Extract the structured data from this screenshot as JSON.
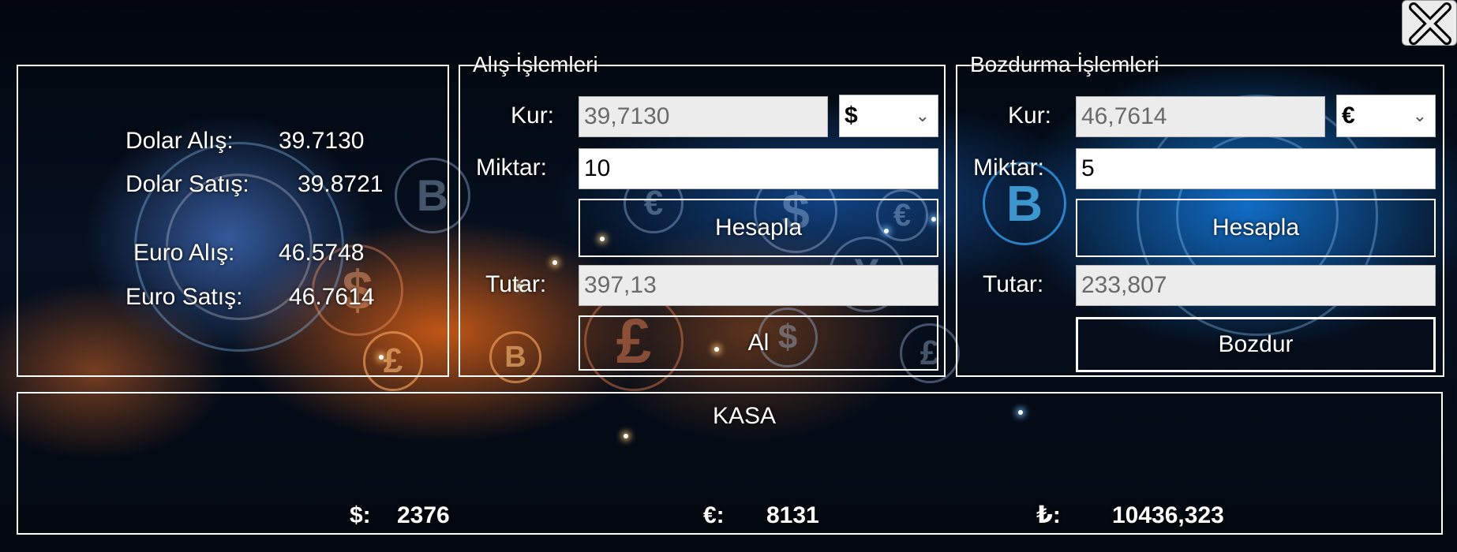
{
  "rates": {
    "dolar_alis_label": "Dolar Alış:",
    "dolar_alis_value": "39.7130",
    "dolar_satis_label": "Dolar Satış:",
    "dolar_satis_value": "39.8721",
    "euro_alis_label": "Euro Alış:",
    "euro_alis_value": "46.5748",
    "euro_satis_label": "Euro Satış:",
    "euro_satis_value": "46.7614"
  },
  "buy": {
    "title": "Alış İşlemleri",
    "kur_label": "Kur:",
    "kur_value": "39,7130",
    "currency": "$",
    "miktar_label": "Miktar:",
    "miktar_value": "10",
    "calc_button": "Hesapla",
    "tutar_label": "Tutar:",
    "tutar_value": "397,13",
    "action_button": "Al"
  },
  "sell": {
    "title": "Bozdurma İşlemleri",
    "kur_label": "Kur:",
    "kur_value": "46,7614",
    "currency": "€",
    "miktar_label": "Miktar:",
    "miktar_value": "5",
    "calc_button": "Hesapla",
    "tutar_label": "Tutar:",
    "tutar_value": "233,807",
    "action_button": "Bozdur"
  },
  "kasa": {
    "title": "KASA",
    "usd_label": "$:",
    "usd_value": "2376",
    "eur_label": "€:",
    "eur_value": "8131",
    "try_label": "₺:",
    "try_value": "10436,323"
  },
  "icons": {
    "close": "close-icon",
    "chevron": "chevron-down-icon"
  }
}
